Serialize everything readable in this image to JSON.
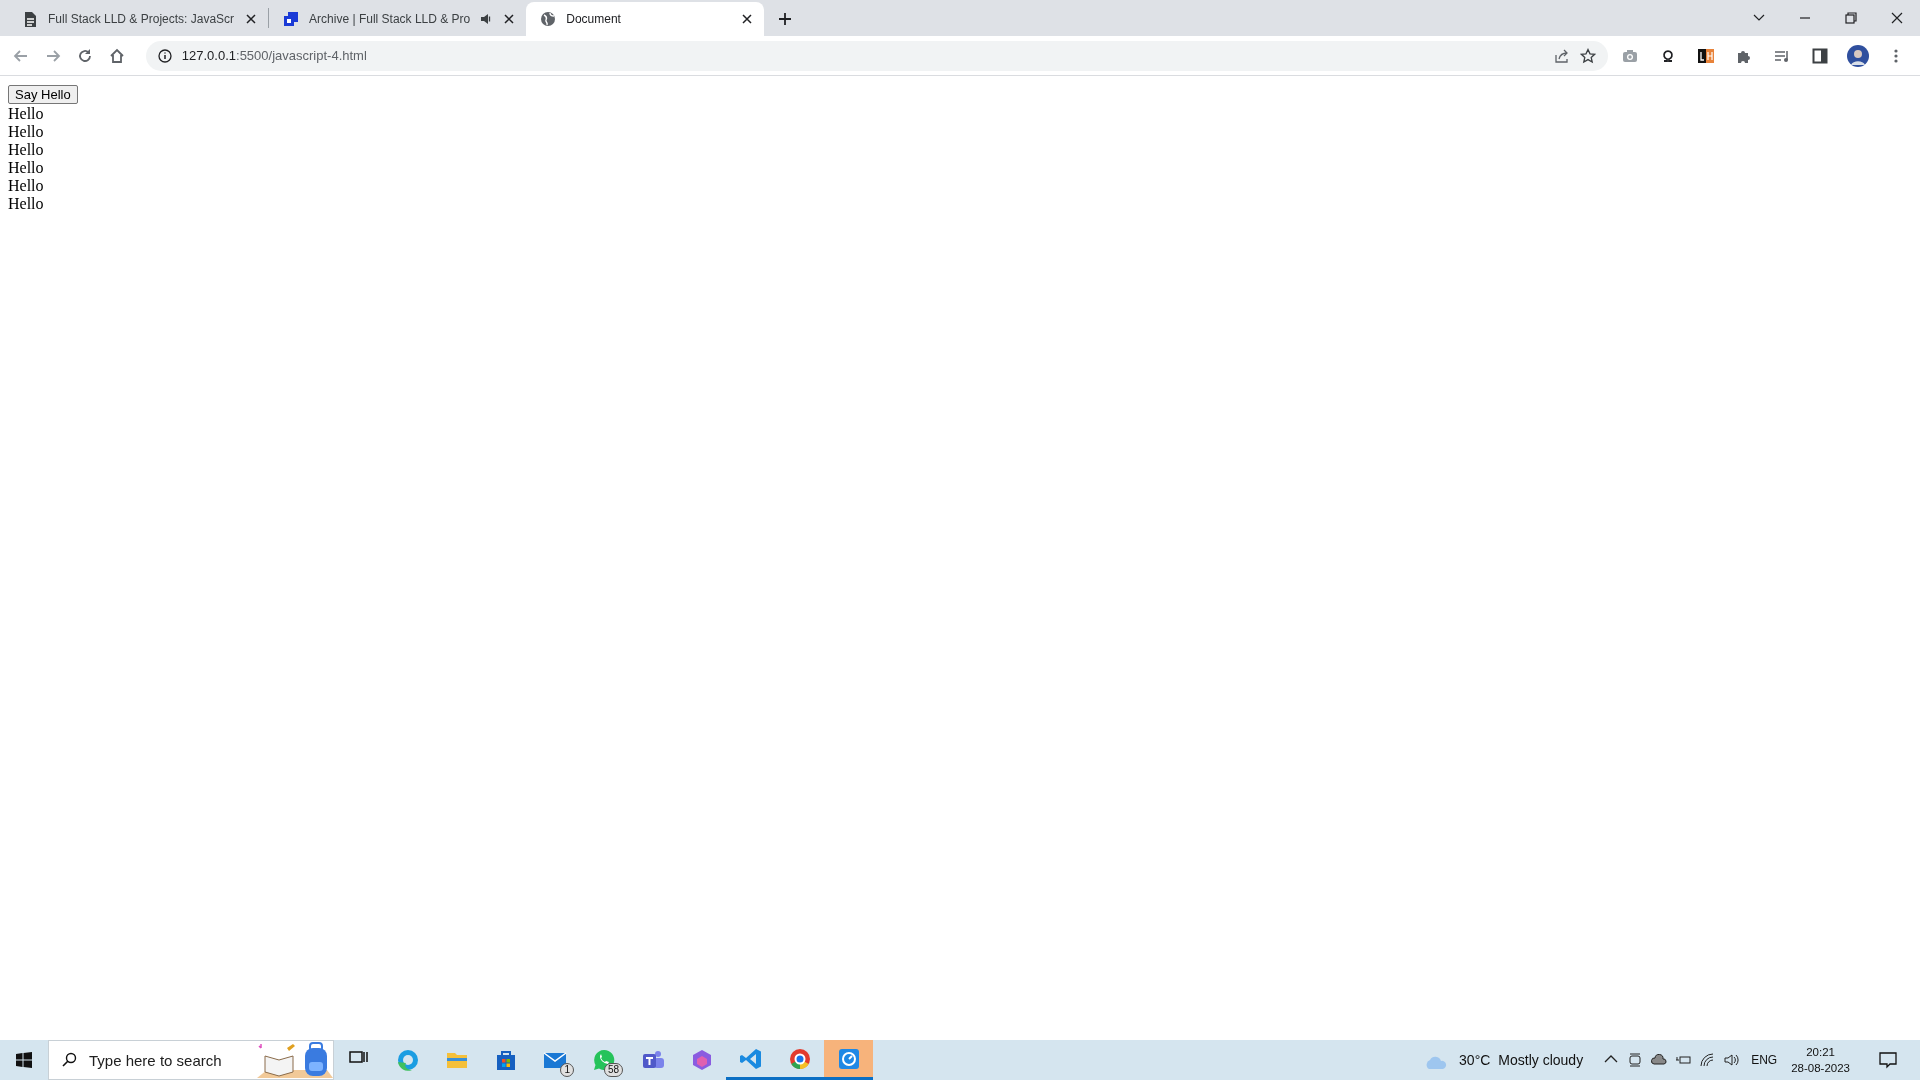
{
  "browser": {
    "tabs": [
      {
        "title": "Full Stack LLD & Projects: JavaScr",
        "kind": "document",
        "selected": false,
        "audio": false
      },
      {
        "title": "Archive | Full Stack LLD & Pro",
        "kind": "site",
        "selected": false,
        "audio": true
      },
      {
        "title": "Document",
        "kind": "globe",
        "selected": true,
        "audio": false
      }
    ],
    "address": {
      "host": "127.0.0.1",
      "rest": ":5500/javascript-4.html"
    }
  },
  "page": {
    "button": "Say Hello",
    "lines": [
      "Hello",
      "Hello",
      "Hello",
      "Hello",
      "Hello",
      "Hello"
    ]
  },
  "taskbar": {
    "search_placeholder": "Type here to search",
    "apps": [
      {
        "kind": "taskview",
        "running": false,
        "selected": false
      },
      {
        "kind": "edge",
        "running": false,
        "selected": false
      },
      {
        "kind": "folder",
        "running": false,
        "selected": false
      },
      {
        "kind": "store",
        "running": false,
        "selected": false
      },
      {
        "kind": "mail",
        "running": false,
        "selected": false,
        "badge": "1"
      },
      {
        "kind": "chat",
        "running": false,
        "selected": false,
        "badge": "58"
      },
      {
        "kind": "teams",
        "running": false,
        "selected": false
      },
      {
        "kind": "hex",
        "running": false,
        "selected": false
      },
      {
        "kind": "code",
        "running": true,
        "selected": false
      },
      {
        "kind": "chrome",
        "running": true,
        "selected": false
      },
      {
        "kind": "gauge",
        "running": true,
        "selected": true
      }
    ],
    "weather": {
      "temperature": "30°C",
      "condition": "Mostly cloudy"
    },
    "language": "ENG",
    "time": "20:21",
    "date": "28-08-2023"
  }
}
